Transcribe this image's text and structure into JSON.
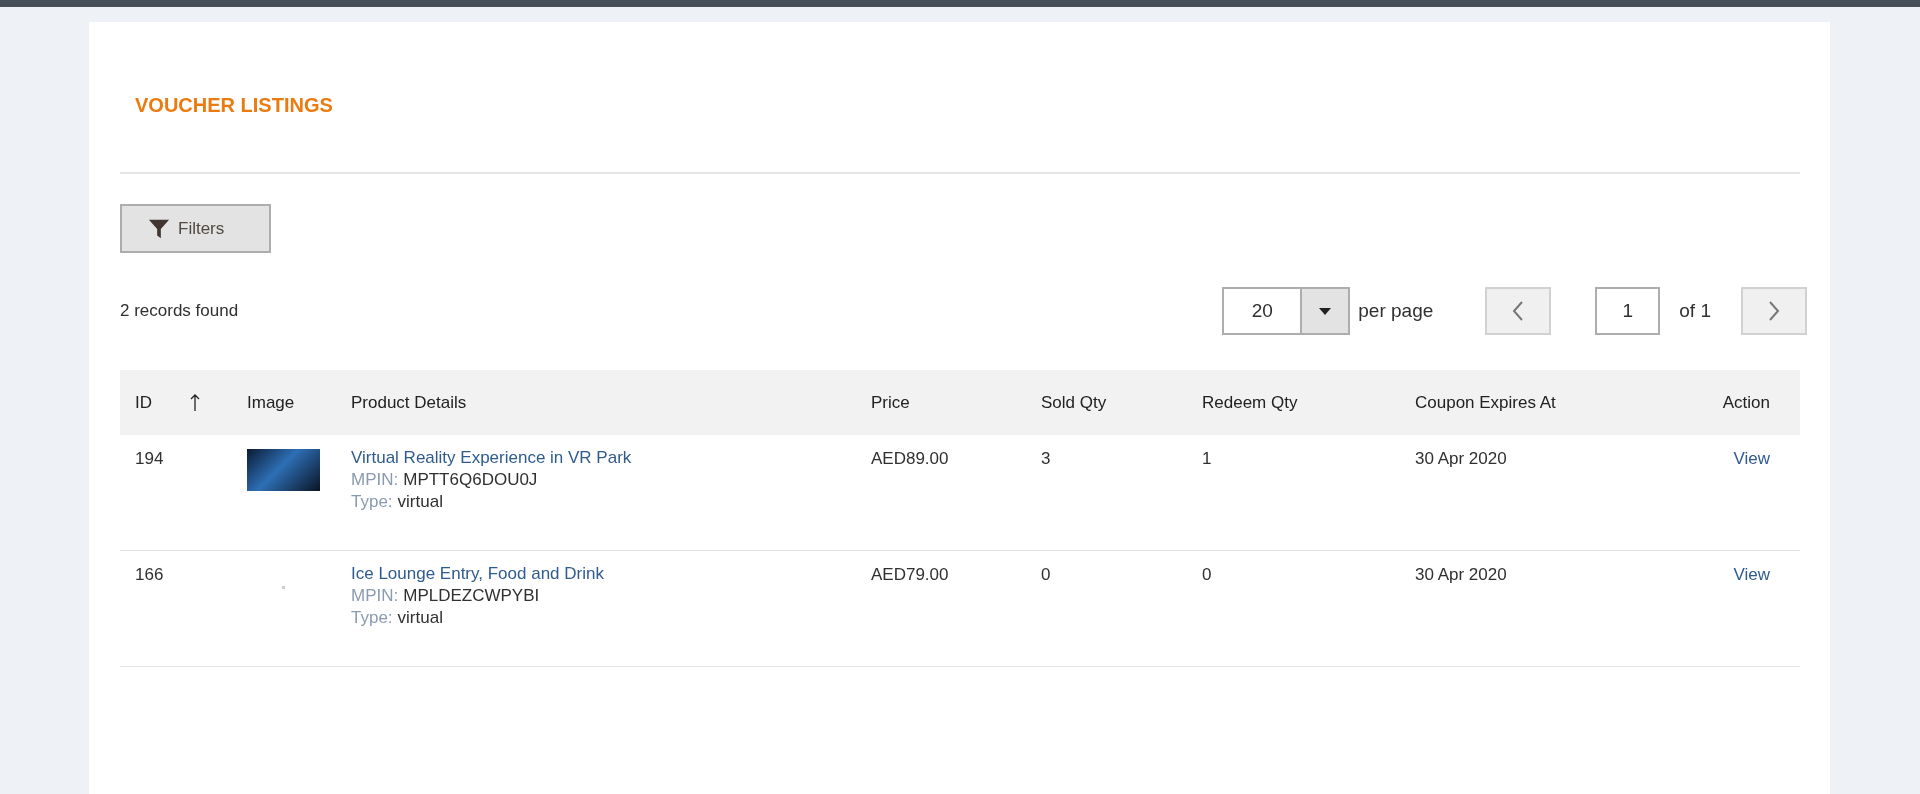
{
  "page_title": "VOUCHER LISTINGS",
  "filters_button": "Filters",
  "records_found": "2 records found",
  "pagination": {
    "per_page_value": "20",
    "per_page_label": "per page",
    "page_value": "1",
    "page_total": "of 1"
  },
  "table": {
    "columns": [
      {
        "label": "ID",
        "sorted": true
      },
      {
        "label": "Image",
        "sorted": false
      },
      {
        "label": "Product Details",
        "sorted": false
      },
      {
        "label": "Price",
        "sorted": false
      },
      {
        "label": "Sold Qty",
        "sorted": false
      },
      {
        "label": "Redeem Qty",
        "sorted": false
      },
      {
        "label": "Coupon Expires At",
        "sorted": false
      },
      {
        "label": "Action",
        "sorted": false
      }
    ],
    "rows": [
      {
        "id": "194",
        "kind": "photo",
        "title": "Virtual Reality Experience in VR Park",
        "mpin_label": "MPIN:",
        "mpin": "MPTT6Q6DOU0J",
        "type_label": "Type:",
        "type": "virtual",
        "price": "AED89.00",
        "sold_qty": "3",
        "redeem_qty": "1",
        "expires": "30 Apr 2020",
        "action": "View"
      },
      {
        "id": "166",
        "kind": "blank",
        "title": "Ice Lounge Entry, Food and Drink",
        "mpin_label": "MPIN:",
        "mpin": "MPLDEZCWPYBI",
        "type_label": "Type:",
        "type": "virtual",
        "price": "AED79.00",
        "sold_qty": "0",
        "redeem_qty": "0",
        "expires": "30 Apr 2020",
        "action": "View"
      }
    ]
  }
}
